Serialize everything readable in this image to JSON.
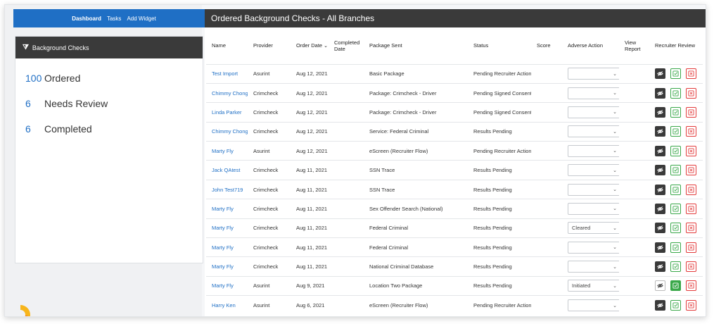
{
  "nav": {
    "dashboard": "Dashboard",
    "tasks": "Tasks",
    "add_widget": "Add Widget"
  },
  "left_card": {
    "title": "Background Checks",
    "stats": [
      {
        "num": "100",
        "label": "Ordered"
      },
      {
        "num": "6",
        "label": "Needs Review"
      },
      {
        "num": "6",
        "label": "Completed"
      }
    ]
  },
  "main": {
    "title": "Ordered Background Checks - All Branches",
    "columns": {
      "name": "Name",
      "provider": "Provider",
      "order_date": "Order Date",
      "completed_1": "Completed",
      "completed_2": "Date",
      "package": "Package Sent",
      "status": "Status",
      "score": "Score",
      "adverse": "Adverse Action",
      "view_1": "View",
      "view_2": "Report",
      "recruiter": "Recruiter Review"
    },
    "rows": [
      {
        "name": "Test Import",
        "provider": "Asurint",
        "date": "Aug 12, 2021",
        "package": "Basic Package",
        "status": "Pending Recruiter Action",
        "adverse": ""
      },
      {
        "name": "Chimmy Chonga",
        "provider": "Crimcheck",
        "date": "Aug 12, 2021",
        "package": "Package: Crimcheck - Driver",
        "status": "Pending Signed Consent",
        "adverse": ""
      },
      {
        "name": "Linda Parker",
        "provider": "Crimcheck",
        "date": "Aug 12, 2021",
        "package": "Package: Crimcheck - Driver",
        "status": "Pending Signed Consent",
        "adverse": ""
      },
      {
        "name": "Chimmy Chonga",
        "provider": "Crimcheck",
        "date": "Aug 12, 2021",
        "package": "Service: Federal Criminal",
        "status": "Results Pending",
        "adverse": ""
      },
      {
        "name": "Marty Fly",
        "provider": "Asurint",
        "date": "Aug 12, 2021",
        "package": "eScreen (Recruiter Flow)",
        "status": "Pending Recruiter Action",
        "adverse": ""
      },
      {
        "name": "Jack QAtest",
        "provider": "Crimcheck",
        "date": "Aug 11, 2021",
        "package": "SSN Trace",
        "status": "Results Pending",
        "adverse": ""
      },
      {
        "name": "John Test719",
        "provider": "Crimcheck",
        "date": "Aug 11, 2021",
        "package": "SSN Trace",
        "status": "Results Pending",
        "adverse": ""
      },
      {
        "name": "Marty Fly",
        "provider": "Crimcheck",
        "date": "Aug 11, 2021",
        "package": "Sex Offender Search (National)",
        "status": "Results Pending",
        "adverse": ""
      },
      {
        "name": "Marty Fly",
        "provider": "Crimcheck",
        "date": "Aug 11, 2021",
        "package": "Federal Criminal",
        "status": "Results Pending",
        "adverse": "Cleared"
      },
      {
        "name": "Marty Fly",
        "provider": "Crimcheck",
        "date": "Aug 11, 2021",
        "package": "Federal Criminal",
        "status": "Results Pending",
        "adverse": ""
      },
      {
        "name": "Marty Fly",
        "provider": "Crimcheck",
        "date": "Aug 11, 2021",
        "package": "National Criminal Database",
        "status": "Results Pending",
        "adverse": ""
      },
      {
        "name": "Marty Fly",
        "provider": "Asurint",
        "date": "Aug 9, 2021",
        "package": "Location Two Package",
        "status": "Results Pending",
        "adverse": "Initiated",
        "reviewed": true
      },
      {
        "name": "Harry Ken",
        "provider": "Asurint",
        "date": "Aug 6, 2021",
        "package": "eScreen (Recruiter Flow)",
        "status": "Pending Recruiter Action",
        "adverse": ""
      }
    ]
  }
}
